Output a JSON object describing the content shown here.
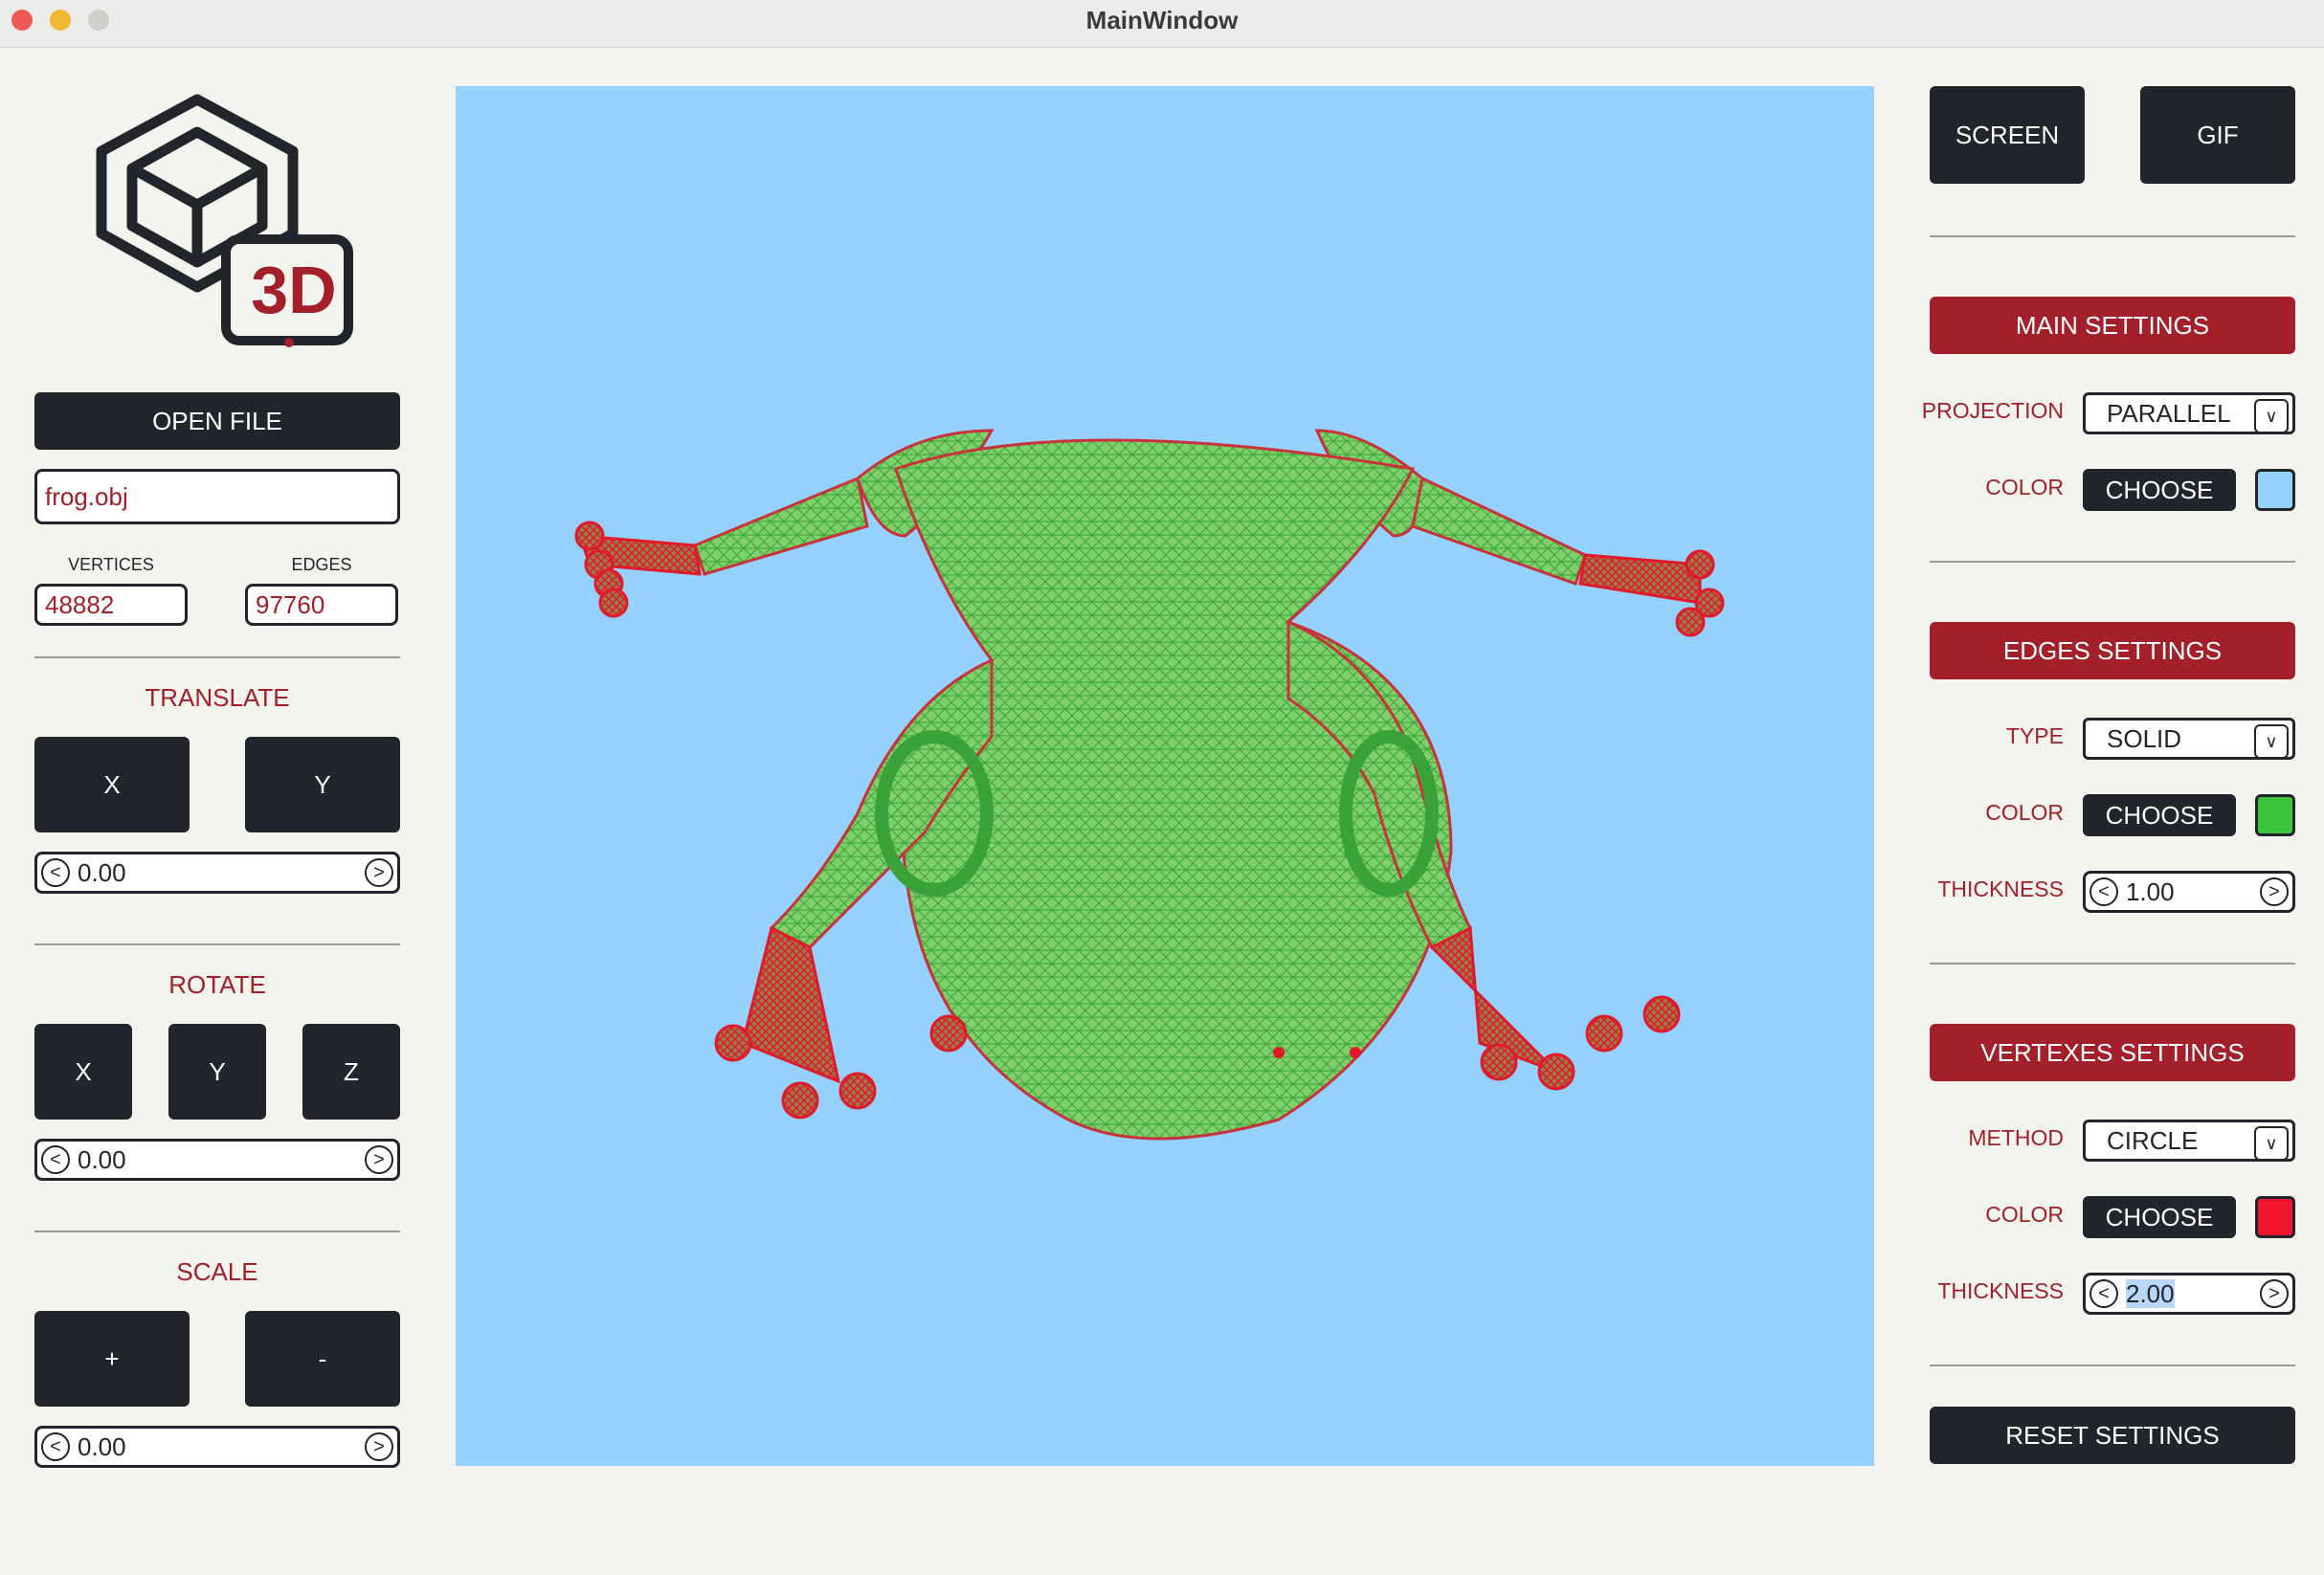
{
  "window": {
    "title": "MainWindow"
  },
  "logo": {
    "badge_text": "3D"
  },
  "file": {
    "open_label": "OPEN FILE",
    "filename": "frog.obj"
  },
  "stats": {
    "vertices_label": "VERTICES",
    "vertices": "48882",
    "edges_label": "EDGES",
    "edges": "97760"
  },
  "translate": {
    "title": "TRANSLATE",
    "x_label": "X",
    "y_label": "Y",
    "value": "0.00",
    "left_arrow": "<",
    "right_arrow": ">"
  },
  "rotate": {
    "title": "ROTATE",
    "x_label": "X",
    "y_label": "Y",
    "z_label": "Z",
    "value": "0.00"
  },
  "scale": {
    "title": "SCALE",
    "plus_label": "+",
    "minus_label": "-",
    "value": "0.00"
  },
  "capture": {
    "screen_label": "SCREEN",
    "gif_label": "GIF"
  },
  "main_settings": {
    "title": "MAIN SETTINGS",
    "projection_label": "PROJECTION",
    "projection_value": "PARALLEL",
    "color_label": "COLOR",
    "choose_label": "CHOOSE",
    "color": "#94d1fd"
  },
  "edges_settings": {
    "title": "EDGES SETTINGS",
    "type_label": "TYPE",
    "type_value": "SOLID",
    "color_label": "COLOR",
    "choose_label": "CHOOSE",
    "color": "#3cc43c",
    "thickness_label": "THICKNESS",
    "thickness": "1.00"
  },
  "vertex_settings": {
    "title": "VERTEXES SETTINGS",
    "method_label": "METHOD",
    "method_value": "CIRCLE",
    "color_label": "COLOR",
    "choose_label": "CHOOSE",
    "color": "#f0142d",
    "thickness_label": "THICKNESS",
    "thickness": "2.00"
  },
  "reset": {
    "label": "RESET SETTINGS"
  },
  "colors": {
    "accent": "#a3202a",
    "dark": "#22252b",
    "background": "#f4f4ef",
    "viewport": "#94d1fd",
    "mesh_edges": "#5cc45c",
    "mesh_vertices": "#e01a2a"
  },
  "icons": {
    "chevron": "chevron-down-icon",
    "arrow_left": "arrow-left-icon",
    "arrow_right": "arrow-right-icon",
    "logo": "cube-logo-icon"
  }
}
